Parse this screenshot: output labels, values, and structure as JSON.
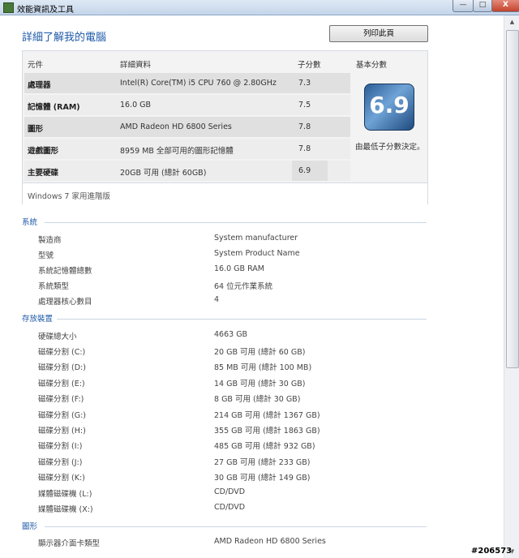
{
  "window": {
    "title": "效能資訊及工具",
    "minimize_glyph": "—",
    "maximize_glyph": "□",
    "close_glyph": "X"
  },
  "header": {
    "title": "詳細了解我的電腦",
    "print_label": "列印此頁"
  },
  "rating_table": {
    "headers": {
      "component": "元件",
      "detail": "詳細資料",
      "subscore": "子分數",
      "base": "基本分數"
    },
    "rows": [
      {
        "component": "處理器",
        "detail": "Intel(R) Core(TM) i5 CPU 760 @ 2.80GHz",
        "subscore": "7.3"
      },
      {
        "component": "記憶體 (RAM)",
        "detail": "16.0 GB",
        "subscore": "7.5"
      },
      {
        "component": "圖形",
        "detail": "AMD Radeon HD 6800 Series",
        "subscore": "7.8"
      },
      {
        "component": "遊戲圖形",
        "detail": "8959 MB 全部可用的圖形記憶體",
        "subscore": "7.8"
      },
      {
        "component": "主要硬碟",
        "detail": "20GB 可用 (總計 60GB)",
        "subscore": "6.9"
      }
    ],
    "base_score": "6.9",
    "base_note": "由最低子分數決定。",
    "edition": "Windows 7 家用進階版"
  },
  "system": {
    "title": "系統",
    "items": [
      {
        "label": "製造商",
        "value": "System manufacturer"
      },
      {
        "label": "型號",
        "value": "System Product Name"
      },
      {
        "label": "系統記憶體總數",
        "value": "16.0 GB RAM"
      },
      {
        "label": "系統類型",
        "value": "64 位元作業系統"
      },
      {
        "label": "處理器核心數目",
        "value": "4"
      }
    ]
  },
  "storage": {
    "title": "存放裝置",
    "items": [
      {
        "label": "硬碟總大小",
        "value": "4663 GB"
      },
      {
        "label": "磁碟分割 (C:)",
        "value": "20 GB 可用 (總計 60 GB)"
      },
      {
        "label": "磁碟分割 (D:)",
        "value": "85 MB 可用 (總計 100 MB)"
      },
      {
        "label": "磁碟分割 (E:)",
        "value": "14 GB 可用 (總計 30 GB)"
      },
      {
        "label": "磁碟分割 (F:)",
        "value": "8 GB 可用 (總計 30 GB)"
      },
      {
        "label": "磁碟分割 (G:)",
        "value": "214 GB 可用 (總計 1367 GB)"
      },
      {
        "label": "磁碟分割 (H:)",
        "value": "355 GB 可用 (總計 1863 GB)"
      },
      {
        "label": "磁碟分割 (I:)",
        "value": "485 GB 可用 (總計 932 GB)"
      },
      {
        "label": "磁碟分割 (J:)",
        "value": "27 GB 可用 (總計 233 GB)"
      },
      {
        "label": "磁碟分割 (K:)",
        "value": "30 GB 可用 (總計 149 GB)"
      },
      {
        "label": "媒體磁碟機 (L:)",
        "value": "CD/DVD"
      },
      {
        "label": "媒體磁碟機 (X:)",
        "value": "CD/DVD"
      }
    ]
  },
  "graphics": {
    "title": "圖形",
    "items": [
      {
        "label": "顯示器介面卡類型",
        "value": "AMD Radeon HD 6800 Series"
      }
    ]
  },
  "watermark": "#206573"
}
